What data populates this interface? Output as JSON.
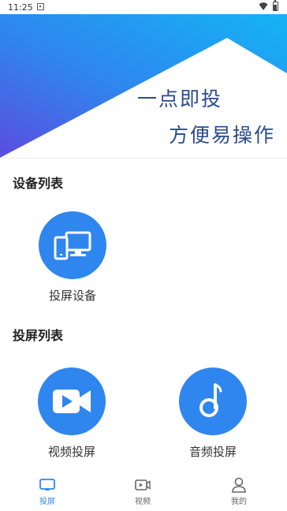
{
  "status_bar": {
    "time": "11:25"
  },
  "banner": {
    "line1": "一点即投",
    "line2": "方便易操作"
  },
  "sections": {
    "devices": {
      "title": "设备列表",
      "items": [
        {
          "label": "投屏设备",
          "icon": "devices-icon"
        }
      ]
    },
    "cast": {
      "title": "投屏列表",
      "items": [
        {
          "label": "视频投屏",
          "icon": "video-camera-icon"
        },
        {
          "label": "音频投屏",
          "icon": "music-note-icon"
        }
      ]
    }
  },
  "tabbar": {
    "tabs": [
      {
        "label": "投屏",
        "icon": "screen-cast-icon",
        "active": true
      },
      {
        "label": "视频",
        "icon": "video-icon",
        "active": false
      },
      {
        "label": "我的",
        "icon": "user-icon",
        "active": false
      }
    ]
  },
  "colors": {
    "accent": "#2f86ee",
    "banner_text": "#2a4b8e",
    "banner_gradient_start": "#5b4de0",
    "banner_gradient_end": "#14b4f5"
  }
}
